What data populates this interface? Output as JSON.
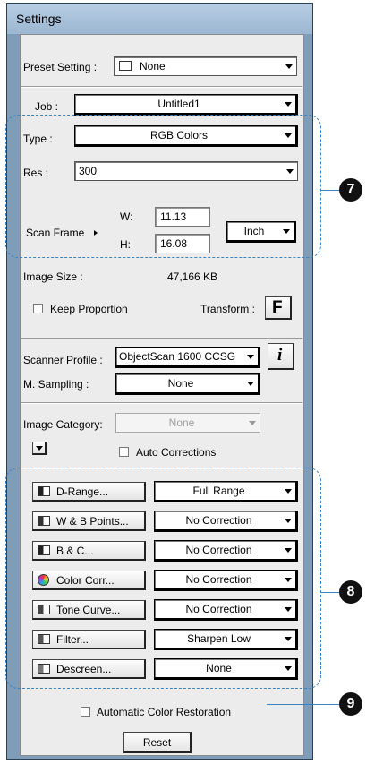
{
  "window": {
    "title": "Settings"
  },
  "preset": {
    "label": "Preset Setting :",
    "value": "None"
  },
  "job": {
    "label": "Job :",
    "value": "Untitled1"
  },
  "type": {
    "label": "Type :",
    "value": "RGB Colors"
  },
  "res": {
    "label": "Res :",
    "value": "300"
  },
  "scan_frame": {
    "label": "Scan Frame",
    "w_label": "W:",
    "w_value": "11.13",
    "h_label": "H:",
    "h_value": "16.08",
    "unit": "Inch"
  },
  "image_size": {
    "label": "Image Size :",
    "value": "47,166 KB"
  },
  "keep_proportion": {
    "label": "Keep Proportion",
    "checked": false
  },
  "transform": {
    "label": "Transform :",
    "button": "F"
  },
  "scanner_profile": {
    "label": "Scanner Profile :",
    "value": "ObjectScan 1600 CCSG",
    "info_button": "i"
  },
  "m_sampling": {
    "label": "M. Sampling :",
    "value": "None"
  },
  "image_category": {
    "label": "Image Category:",
    "value": "None"
  },
  "auto_corrections": {
    "label": "Auto Corrections",
    "checked": false
  },
  "corrections": [
    {
      "button": "D-Range...",
      "value": "Full Range",
      "icon": "d-range-icon",
      "color": "#222222"
    },
    {
      "button": "W & B Points...",
      "value": "No Correction",
      "icon": "wb-points-icon",
      "color": "#333333"
    },
    {
      "button": "B & C...",
      "value": "No Correction",
      "icon": "brightness-contrast-icon",
      "color": "#222222"
    },
    {
      "button": "Color Corr...",
      "value": "No Correction",
      "icon": "color-wheel-icon",
      "color": "#cc3366"
    },
    {
      "button": "Tone Curve...",
      "value": "No Correction",
      "icon": "tone-curve-icon",
      "color": "#444444"
    },
    {
      "button": "Filter...",
      "value": "Sharpen Low",
      "icon": "filter-icon",
      "color": "#555555"
    },
    {
      "button": "Descreen...",
      "value": "None",
      "icon": "descreen-icon",
      "color": "#777777"
    }
  ],
  "auto_color_restoration": {
    "label": "Automatic Color Restoration",
    "checked": false
  },
  "reset": {
    "label": "Reset"
  },
  "callouts": {
    "seven": "7",
    "eight": "8",
    "nine": "9"
  },
  "colors": {
    "callout_line": "#3b84c4",
    "frame": "#7f9cb8",
    "panel": "#ececec"
  }
}
